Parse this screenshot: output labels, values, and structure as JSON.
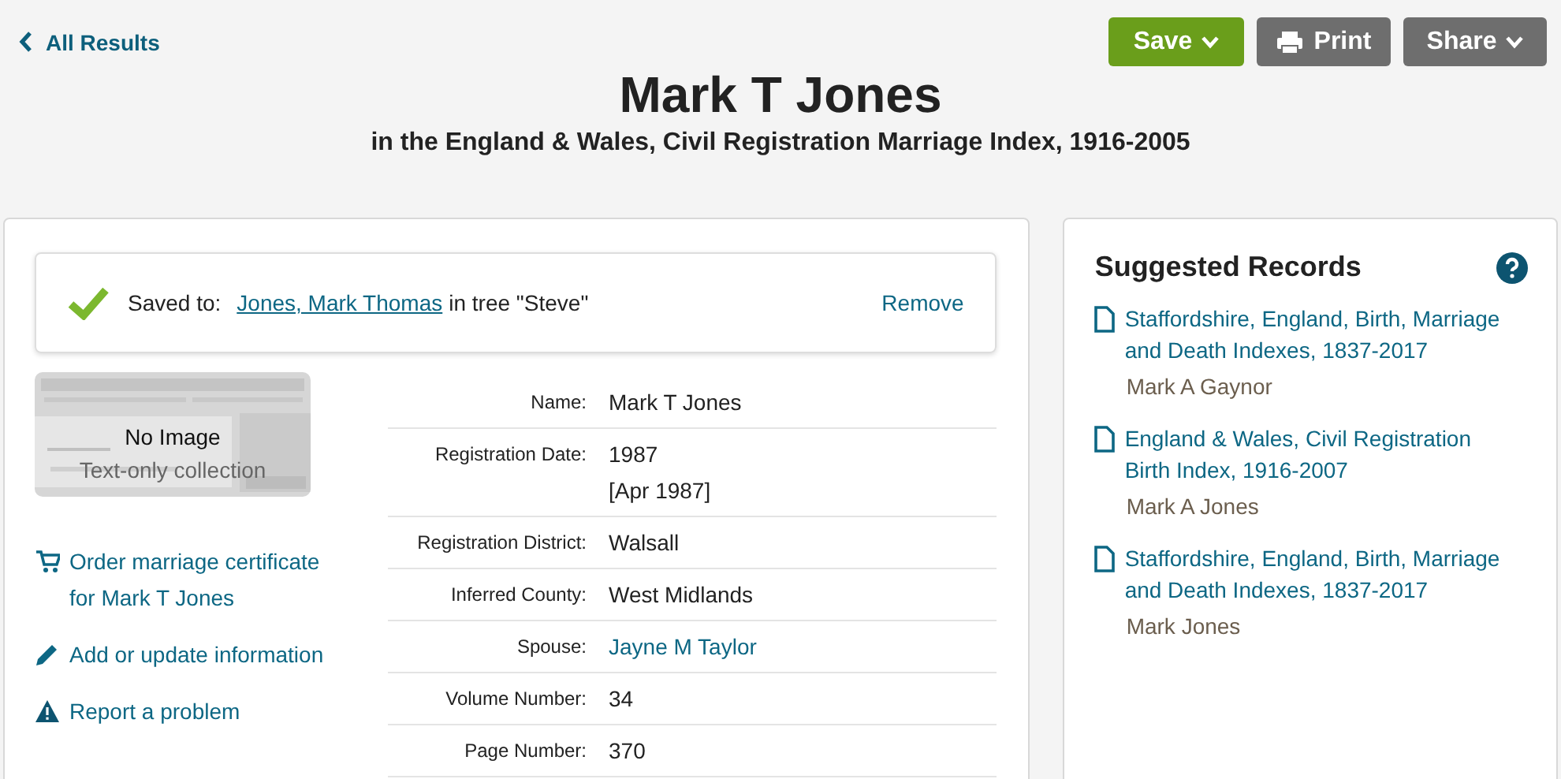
{
  "back_link": "All Results",
  "actions": [
    {
      "label": "Save",
      "kind": "save"
    },
    {
      "label": "Print",
      "kind": "print"
    },
    {
      "label": "Share",
      "kind": "share"
    }
  ],
  "title": "Mark T Jones",
  "subtitle": "in the England & Wales, Civil Registration Marriage Index, 1916-2005",
  "saved": {
    "label": "Saved to:",
    "person": "Jones, Mark Thomas",
    "tree_text": "in tree \"Steve\"",
    "remove": "Remove"
  },
  "image": {
    "kind": "picture",
    "title": "No Image",
    "caption": "Text-only collection"
  },
  "links": [
    {
      "kind": "cart",
      "text": "Order marriage certificate for Mark T Jones"
    },
    {
      "kind": "pencil",
      "text": "Add or update information"
    },
    {
      "kind": "warning",
      "text": "Report a problem"
    }
  ],
  "facts": [
    {
      "label": "Name:",
      "values": [
        "Mark T Jones"
      ],
      "kind": "text"
    },
    {
      "label": "Registration Date:",
      "values": [
        "1987",
        "[Apr 1987]"
      ],
      "kind": "text"
    },
    {
      "label": "Registration District:",
      "values": [
        "Walsall"
      ],
      "kind": "text"
    },
    {
      "label": "Inferred County:",
      "values": [
        "West Midlands"
      ],
      "kind": "text"
    },
    {
      "label": "Spouse:",
      "values": [
        "Jayne M Taylor"
      ],
      "kind": "link"
    },
    {
      "label": "Volume Number:",
      "values": [
        "34"
      ],
      "kind": "text"
    },
    {
      "label": "Page Number:",
      "values": [
        "370"
      ],
      "kind": "text"
    }
  ],
  "suggested": {
    "title": "Suggested Records",
    "records": [
      {
        "collection": "Staffordshire, England, Birth, Marriage and Death Indexes, 1837-2017",
        "person": "Mark A Gaynor"
      },
      {
        "collection": "England & Wales, Civil Registration Birth Index, 1916-2007",
        "person": "Mark A Jones"
      },
      {
        "collection": "Staffordshire, England, Birth, Marriage and Death Indexes, 1837-2017",
        "person": "Mark Jones"
      }
    ]
  }
}
